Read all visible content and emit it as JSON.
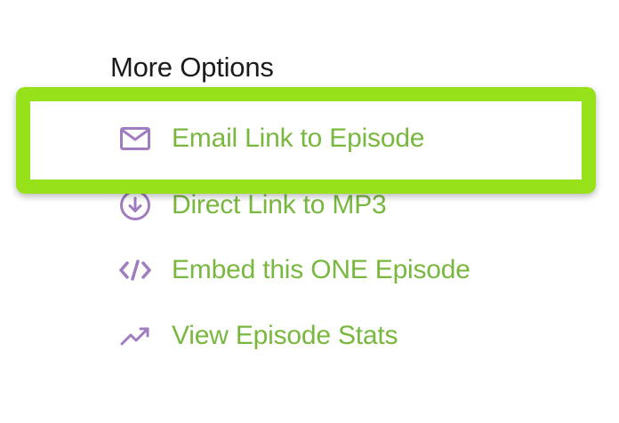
{
  "section": {
    "title": "More Options"
  },
  "options": [
    {
      "label": "Email Link to Episode",
      "icon": "mail-icon"
    },
    {
      "label": "Direct Link to MP3",
      "icon": "download-circle-icon"
    },
    {
      "label": "Embed this ONE Episode",
      "icon": "code-icon"
    },
    {
      "label": "View Episode Stats",
      "icon": "trending-up-icon"
    }
  ],
  "colors": {
    "heading": "#1b1b1b",
    "link": "#79b83f",
    "icon": "#a07cc0",
    "highlight": "#97e11a"
  }
}
